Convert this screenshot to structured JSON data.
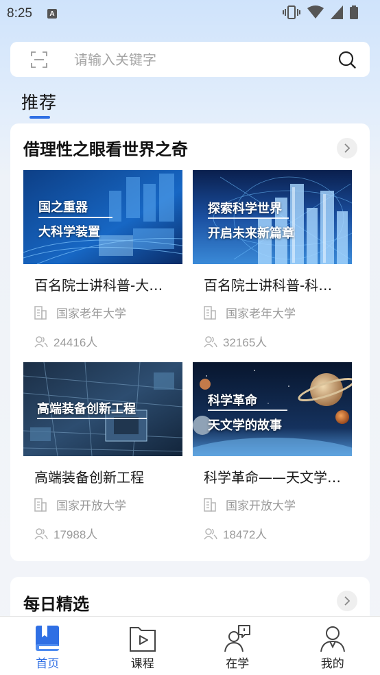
{
  "status_bar": {
    "time": "8:25",
    "notif_letter": "A"
  },
  "search": {
    "placeholder": "请输入关键字"
  },
  "section_tab": {
    "label": "推荐"
  },
  "featured": {
    "title": "借理性之眼看世界之奇",
    "courses": [
      {
        "name": "百名院士讲科普-大…",
        "org": "国家老年大学",
        "count": "24416人",
        "thumb_lines": [
          "国之重器",
          "大科学装置"
        ]
      },
      {
        "name": "百名院士讲科普-科…",
        "org": "国家老年大学",
        "count": "32165人",
        "thumb_lines": [
          "探索科学世界",
          "开启未来新篇章"
        ]
      },
      {
        "name": "高端装备创新工程",
        "org": "国家开放大学",
        "count": "17988人",
        "thumb_lines": [
          "高端装备创新工程"
        ]
      },
      {
        "name": "科学革命——天文学…",
        "org": "国家开放大学",
        "count": "18472人",
        "thumb_lines": [
          "科学革命",
          "天文学的故事"
        ]
      }
    ]
  },
  "daily": {
    "title": "每日精选"
  },
  "tab_bar": {
    "items": [
      {
        "label": "首页",
        "icon": "book-icon",
        "active": true
      },
      {
        "label": "课程",
        "icon": "play-folder-icon",
        "active": false
      },
      {
        "label": "在学",
        "icon": "learner-chat-icon",
        "active": false
      },
      {
        "label": "我的",
        "icon": "user-profile-icon",
        "active": false
      }
    ]
  },
  "colors": {
    "accent": "#2f6fe4",
    "muted_text": "#9a9a9a"
  }
}
